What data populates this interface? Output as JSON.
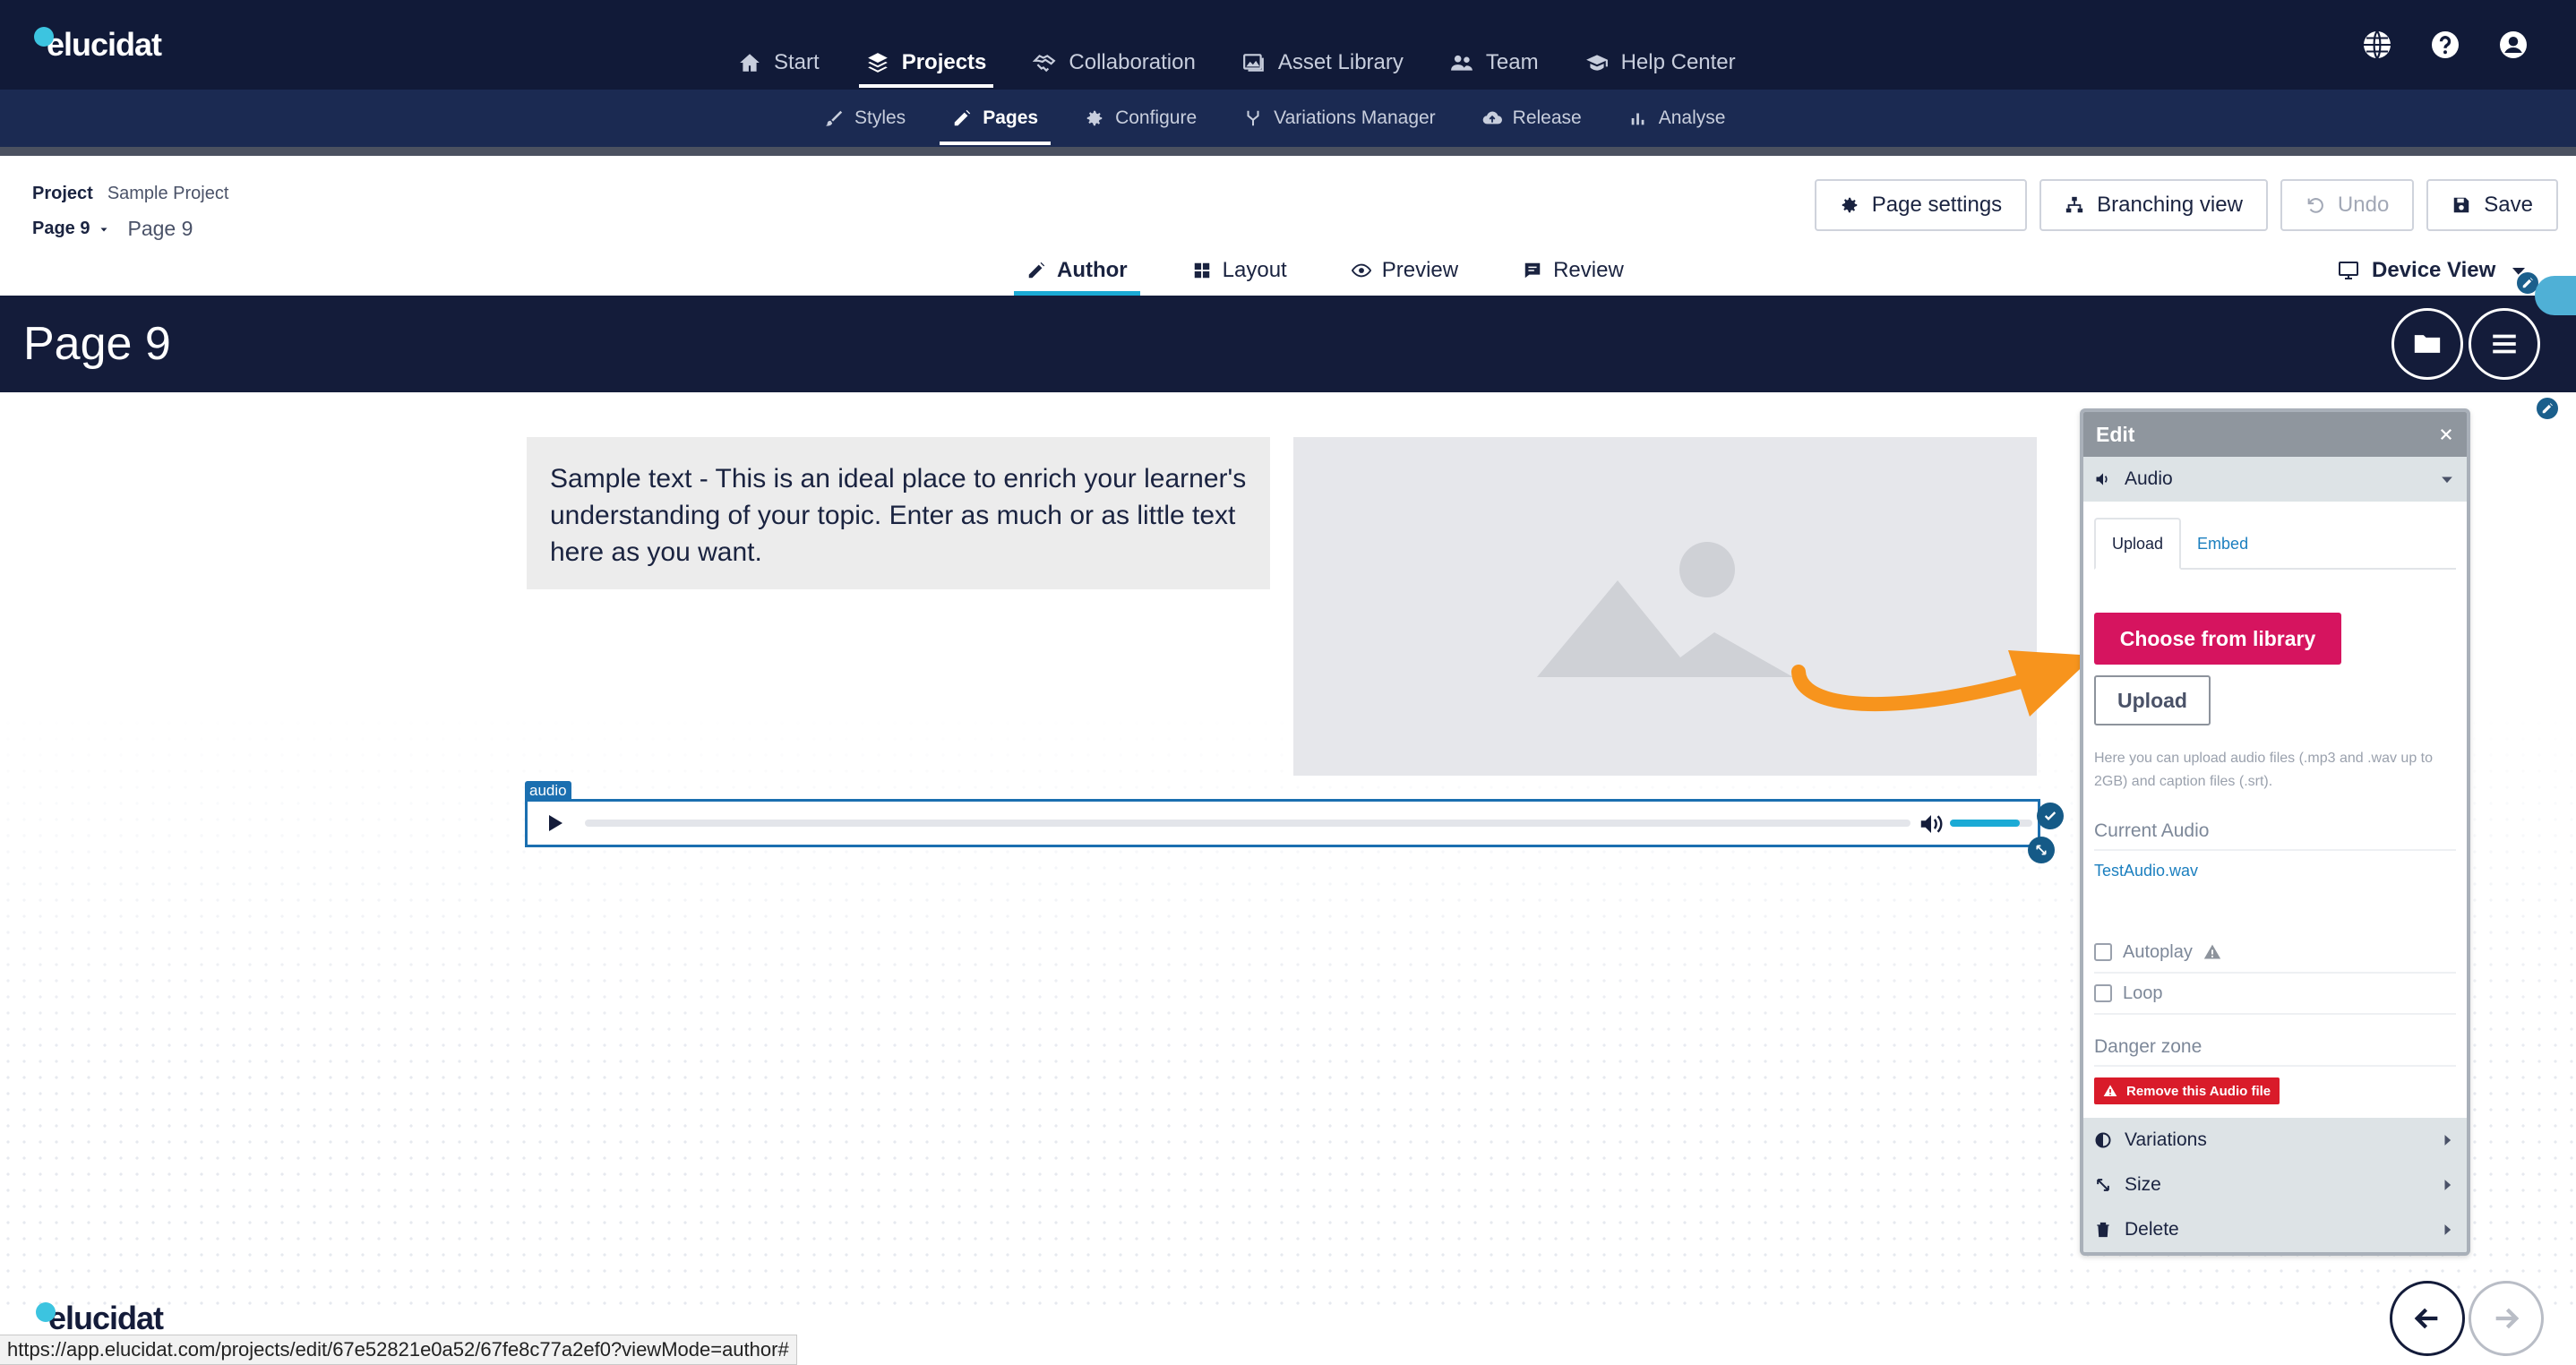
{
  "brand": {
    "logo_text": "elucidat",
    "accent": "#3cc4e0",
    "nav_bg": "#111a38"
  },
  "top_nav": {
    "items": [
      {
        "label": "Start",
        "icon": "home-icon"
      },
      {
        "label": "Projects",
        "icon": "layers-icon",
        "active": true
      },
      {
        "label": "Collaboration",
        "icon": "handshake-icon"
      },
      {
        "label": "Asset Library",
        "icon": "images-icon"
      },
      {
        "label": "Team",
        "icon": "users-icon"
      },
      {
        "label": "Help Center",
        "icon": "graduation-cap-icon"
      }
    ],
    "right_icons": [
      "globe-icon",
      "help-icon",
      "user-icon"
    ]
  },
  "sub_nav": {
    "items": [
      {
        "label": "Styles",
        "icon": "brush-icon"
      },
      {
        "label": "Pages",
        "icon": "pencil-icon",
        "active": true
      },
      {
        "label": "Configure",
        "icon": "gear-icon"
      },
      {
        "label": "Variations Manager",
        "icon": "branch-icon"
      },
      {
        "label": "Release",
        "icon": "cloud-upload-icon"
      },
      {
        "label": "Analyse",
        "icon": "bar-chart-icon"
      }
    ]
  },
  "project": {
    "label": "Project",
    "name": "Sample Project",
    "page_select": "Page 9",
    "page_name": "Page 9"
  },
  "toolbar": {
    "page_settings": "Page settings",
    "branching_view": "Branching view",
    "undo": "Undo",
    "save": "Save"
  },
  "view_tabs": {
    "items": [
      {
        "label": "Author",
        "icon": "pencil-icon",
        "active": true
      },
      {
        "label": "Layout",
        "icon": "grid-icon"
      },
      {
        "label": "Preview",
        "icon": "eye-icon"
      },
      {
        "label": "Review",
        "icon": "comment-icon"
      }
    ],
    "device_view": "Device View"
  },
  "page": {
    "title": "Page 9",
    "sample_text": "Sample text - This is an ideal place to enrich your learner's understanding of your topic. Enter as much or as little text here as you want.",
    "audio_tag": "audio",
    "audio_volume": 0.85
  },
  "edit_panel": {
    "title": "Edit",
    "component_type": "Audio",
    "tabs": [
      "Upload",
      "Embed"
    ],
    "choose_library": "Choose from library",
    "upload": "Upload",
    "upload_help": "Here you can upload audio files (.mp3 and .wav up to 2GB) and caption files (.srt).",
    "current_audio_label": "Current Audio",
    "current_audio_file": "TestAudio.wav",
    "autoplay": "Autoplay",
    "loop": "Loop",
    "danger_zone": "Danger zone",
    "remove": "Remove this Audio file",
    "footer": [
      "Variations",
      "Size",
      "Delete"
    ],
    "button_color": "#d6145f",
    "danger_color": "#d91b2a"
  },
  "annotation": {
    "arrow_color": "#f7941d"
  },
  "status_bar": {
    "url": "https://app.elucidat.com/projects/edit/67e52821e0a52/67fe8c77a2ef0?viewMode=author#"
  }
}
